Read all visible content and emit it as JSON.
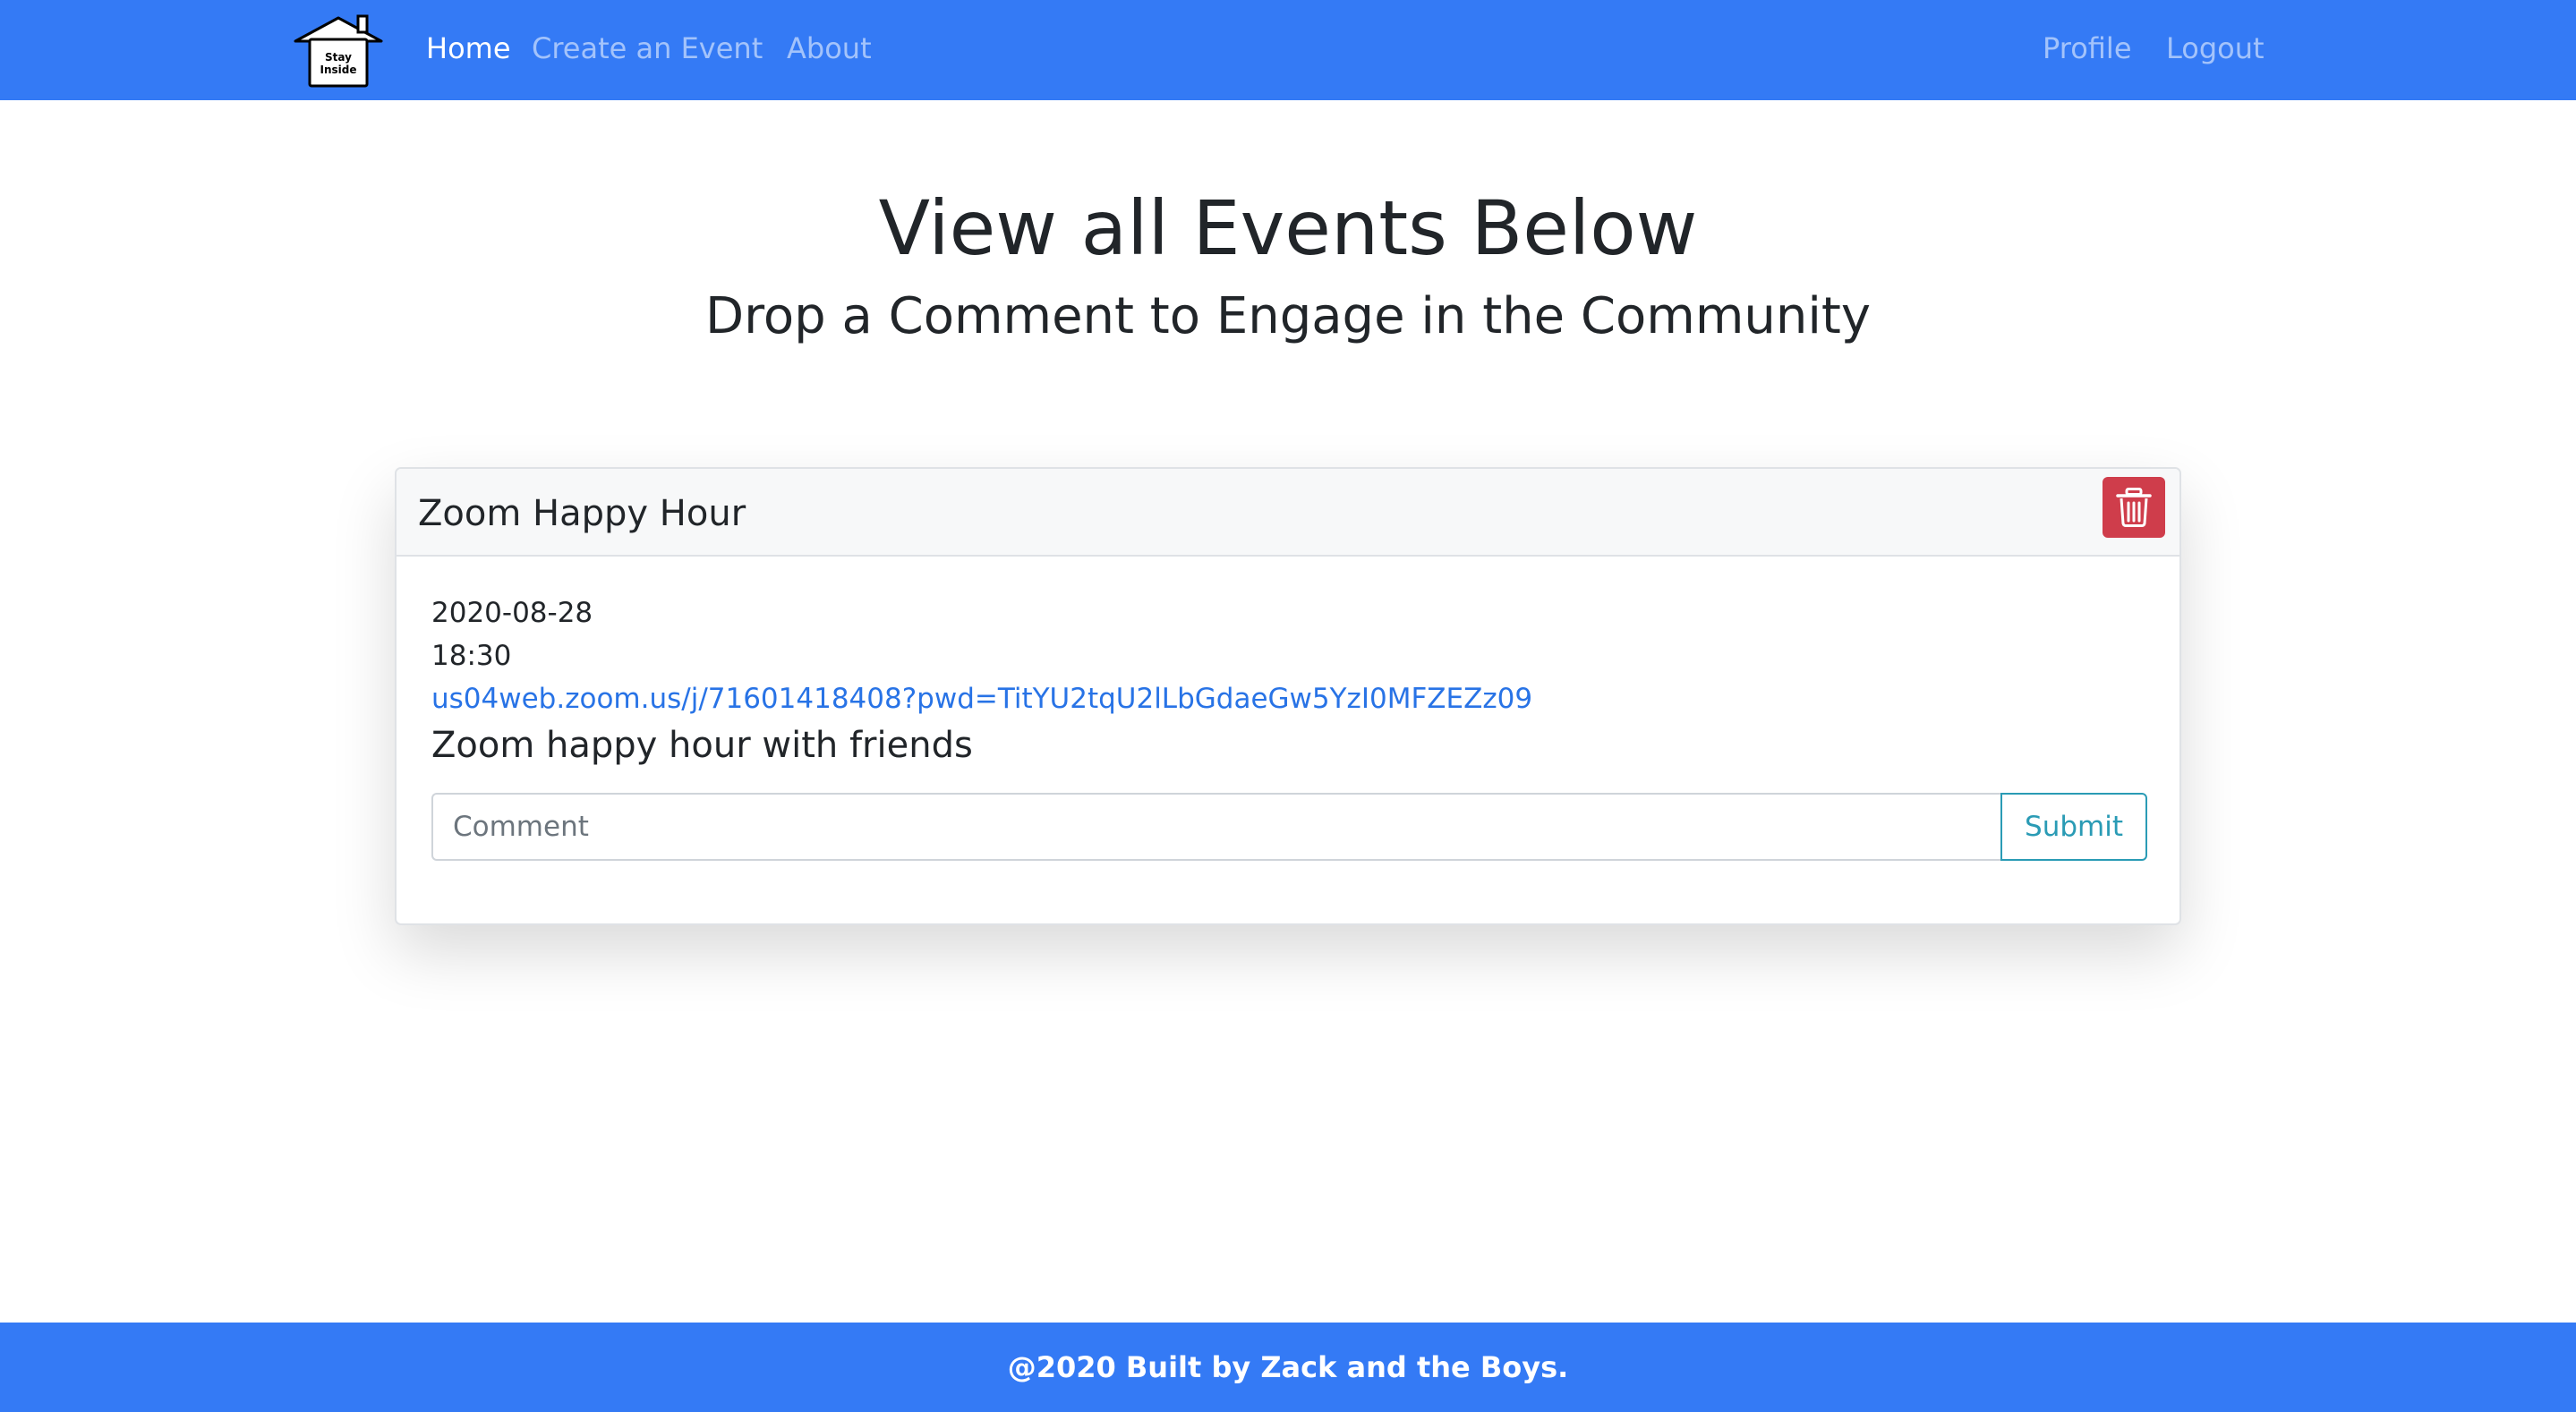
{
  "navbar": {
    "brand_text": [
      "Stay",
      "Inside"
    ],
    "links": [
      {
        "label": "Home",
        "active": true
      },
      {
        "label": "Create an Event",
        "active": false
      },
      {
        "label": "About",
        "active": false
      }
    ],
    "right_links": [
      {
        "label": "Profile"
      },
      {
        "label": "Logout"
      }
    ],
    "color": "#347af5"
  },
  "hero": {
    "title": "View all Events Below",
    "subtitle": "Drop a Comment to Engage in the Community"
  },
  "event": {
    "title": "Zoom Happy Hour",
    "delete_icon": "trash-icon",
    "date": "2020-08-28",
    "time": "18:30",
    "link": "us04web.zoom.us/j/71601418408?pwd=TitYU2tqU2lLbGdaeGw5YzI0MFZEZz09",
    "description": "Zoom happy hour with friends",
    "comment_placeholder": "Comment",
    "submit_label": "Submit"
  },
  "footer": {
    "text": "@2020 Built by Zack and the Boys."
  },
  "colors": {
    "primary": "#347af5",
    "danger": "#cf3d4b",
    "info": "#2a9bb5",
    "link": "#2873e6"
  }
}
